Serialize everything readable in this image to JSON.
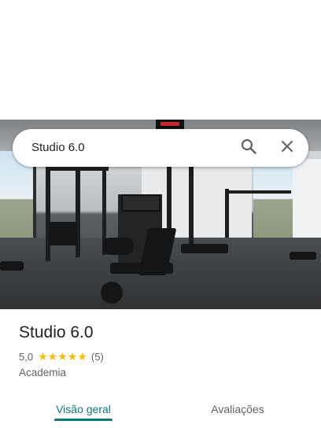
{
  "search": {
    "query": "Studio 6.0"
  },
  "place": {
    "name": "Studio 6.0",
    "rating": "5,0",
    "stars": 5,
    "reviews": "(5)",
    "category": "Academia"
  },
  "tabs": [
    {
      "label": "Visão geral",
      "active": true
    },
    {
      "label": "Avaliações",
      "active": false
    }
  ],
  "colors": {
    "accent": "#0b7a75",
    "star": "#fbbc04",
    "secondary_text": "#5f6368"
  },
  "icons": {
    "search": "search-icon",
    "close": "close-icon",
    "star": "star-icon"
  }
}
